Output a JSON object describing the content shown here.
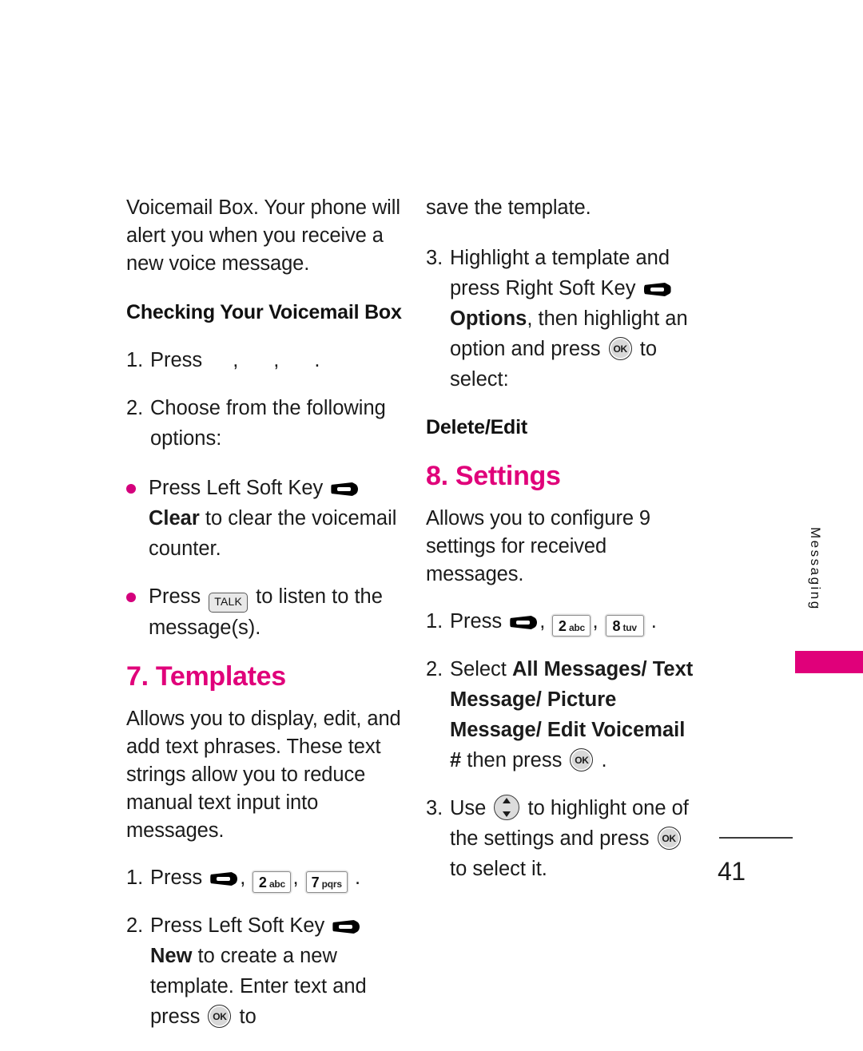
{
  "document": {
    "page_number": "41",
    "side_tab_label": "Messaging",
    "accent_color": "#e0007a",
    "bullet_color": "#d4007c"
  },
  "left_column": {
    "intro_paragraph": "Voicemail Box. Your phone will alert you when you receive a new voice message.",
    "subheading": "Checking Your Voicemail Box",
    "step1": {
      "number": "1.",
      "lead": "Press",
      "sep1": ",",
      "sep2": ",",
      "end": "."
    },
    "step2": {
      "number": "2.",
      "text": "Choose from the following options:"
    },
    "bullets": [
      {
        "lead": "Press Left Soft Key",
        "key_icon": "soft-key-icon",
        "bold_label": "Clear",
        "tail": "to clear the voicemail counter."
      },
      {
        "lead": "Press",
        "key_icon": "talk-key-icon",
        "key_label": "TALK",
        "tail": "to listen to the message(s)."
      }
    ],
    "templates_heading": "7. Templates",
    "templates_paragraph": "Allows you to display, edit, and add text phrases. These text strings allow you to reduce manual text input into messages.",
    "templates_step1": {
      "number": "1.",
      "lead": "Press",
      "key1_icon": "soft-key-icon",
      "sep1": ",",
      "key2_digit": "2",
      "key2_letters": "abc",
      "sep2": ",",
      "key3_digit": "7",
      "key3_letters": "pqrs",
      "end": "."
    },
    "templates_step2": {
      "number": "2.",
      "lead": "Press Left Soft Key",
      "key_icon": "soft-key-icon",
      "bold_label": "New",
      "tail1": "to create a new template. Enter text and press",
      "ok_icon": "ok-key-icon",
      "ok_label": "OK",
      "tail2": "to"
    }
  },
  "right_column": {
    "continuation": "save the template.",
    "templates_step3": {
      "number": "3.",
      "lead": "Highlight a template and press Right Soft Key",
      "key_icon": "soft-key-icon",
      "bold_label": "Options",
      "mid": ", then highlight an option and press",
      "ok_icon": "ok-key-icon",
      "ok_label": "OK",
      "tail": "to select:"
    },
    "delete_edit_subhead": "Delete/Edit",
    "settings_heading": "8. Settings",
    "settings_paragraph": "Allows you to configure 9 settings for received messages.",
    "settings_step1": {
      "number": "1.",
      "lead": "Press",
      "key1_icon": "soft-key-icon",
      "sep1": ",",
      "key2_digit": "2",
      "key2_letters": "abc",
      "sep2": ",",
      "key3_digit": "8",
      "key3_letters": "tuv",
      "end": "."
    },
    "settings_step2": {
      "number": "2.",
      "lead": "Select",
      "bold_options": "All Messages/ Text Message/ Picture Message/ Edit Voicemail #",
      "mid": "then press",
      "ok_icon": "ok-key-icon",
      "ok_label": "OK",
      "end": "."
    },
    "settings_step3": {
      "number": "3.",
      "lead": "Use",
      "nav_icon": "navigation-key-icon",
      "mid": "to highlight one of the settings and press",
      "ok_icon": "ok-key-icon",
      "ok_label": "OK",
      "tail": "to select it."
    }
  }
}
